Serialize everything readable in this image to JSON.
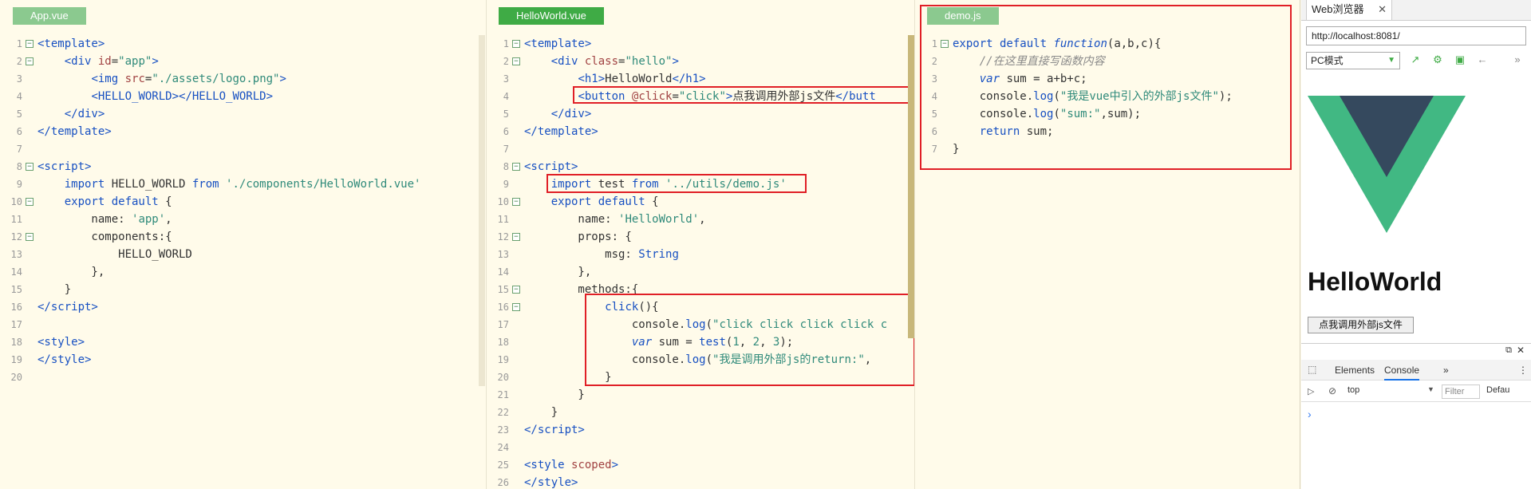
{
  "panes": [
    {
      "tab": "App.vue",
      "lines": [
        {
          "n": "1",
          "f": "⊟",
          "h": "<span class=\"tg\">&lt;template&gt;</span>"
        },
        {
          "n": "2",
          "f": "⊟",
          "h": "    <span class=\"tg\">&lt;div</span> <span class=\"at\">id</span>=<span class=\"st\">\"app\"</span><span class=\"tg\">&gt;</span>"
        },
        {
          "n": "3",
          "f": "",
          "h": "        <span class=\"tg\">&lt;img</span> <span class=\"at\">src</span>=<span class=\"st\">\"./assets/logo.png\"</span><span class=\"tg\">&gt;</span>"
        },
        {
          "n": "4",
          "f": "",
          "h": "        <span class=\"tg\">&lt;HELLO_WORLD&gt;&lt;/HELLO_WORLD&gt;</span>"
        },
        {
          "n": "5",
          "f": "",
          "h": "    <span class=\"tg\">&lt;/div&gt;</span>"
        },
        {
          "n": "6",
          "f": "",
          "h": "<span class=\"tg\">&lt;/template&gt;</span>"
        },
        {
          "n": "7",
          "f": "",
          "h": ""
        },
        {
          "n": "8",
          "f": "⊟",
          "h": "<span class=\"tg\">&lt;script&gt;</span>"
        },
        {
          "n": "9",
          "f": "",
          "h": "    <span class=\"kw\">import</span> HELLO_WORLD <span class=\"kw\">from</span> <span class=\"st\">'./components/HelloWorld.vue'</span>"
        },
        {
          "n": "10",
          "f": "⊟",
          "h": "    <span class=\"kw\">export default</span> {"
        },
        {
          "n": "11",
          "f": "",
          "h": "        name: <span class=\"st\">'app'</span>,"
        },
        {
          "n": "12",
          "f": "⊟",
          "h": "        components:{"
        },
        {
          "n": "13",
          "f": "",
          "h": "            HELLO_WORLD"
        },
        {
          "n": "14",
          "f": "",
          "h": "        },"
        },
        {
          "n": "15",
          "f": "",
          "h": "    }"
        },
        {
          "n": "16",
          "f": "",
          "h": "<span class=\"tg\">&lt;/script&gt;</span>"
        },
        {
          "n": "17",
          "f": "",
          "h": ""
        },
        {
          "n": "18",
          "f": "",
          "h": "<span class=\"tg\">&lt;style&gt;</span>"
        },
        {
          "n": "19",
          "f": "",
          "h": "<span class=\"tg\">&lt;/style&gt;</span>"
        },
        {
          "n": "20",
          "f": "",
          "h": ""
        }
      ]
    },
    {
      "tab": "HelloWorld.vue",
      "lines": [
        {
          "n": "1",
          "f": "⊟",
          "h": "<span class=\"tg\">&lt;template&gt;</span>"
        },
        {
          "n": "2",
          "f": "⊟",
          "h": "    <span class=\"tg\">&lt;div</span> <span class=\"at\">class</span>=<span class=\"st\">\"hello\"</span><span class=\"tg\">&gt;</span>"
        },
        {
          "n": "3",
          "f": "",
          "h": "        <span class=\"tg\">&lt;h1&gt;</span>HelloWorld<span class=\"tg\">&lt;/h1&gt;</span>"
        },
        {
          "n": "4",
          "f": "",
          "h": "        <span class=\"tg\">&lt;button</span> <span class=\"at\">@click</span>=<span class=\"st\">\"click\"</span><span class=\"tg\">&gt;</span>点我调用外部js文件<span class=\"tg\">&lt;/butt</span>"
        },
        {
          "n": "5",
          "f": "",
          "h": "    <span class=\"tg\">&lt;/div&gt;</span>"
        },
        {
          "n": "6",
          "f": "",
          "h": "<span class=\"tg\">&lt;/template&gt;</span>"
        },
        {
          "n": "7",
          "f": "",
          "h": ""
        },
        {
          "n": "8",
          "f": "⊟",
          "h": "<span class=\"tg\">&lt;script&gt;</span>"
        },
        {
          "n": "9",
          "f": "",
          "h": "    <span class=\"kw\">import</span> test <span class=\"kw\">from</span> <span class=\"st\">'../utils/demo.js'</span>"
        },
        {
          "n": "10",
          "f": "⊟",
          "h": "    <span class=\"kw\">export default</span> {"
        },
        {
          "n": "11",
          "f": "",
          "h": "        name: <span class=\"st\">'HelloWorld'</span>,"
        },
        {
          "n": "12",
          "f": "⊟",
          "h": "        props: {"
        },
        {
          "n": "13",
          "f": "",
          "h": "            msg: <span class=\"fn\">String</span>"
        },
        {
          "n": "14",
          "f": "",
          "h": "        },"
        },
        {
          "n": "15",
          "f": "⊟",
          "h": "        methods:{"
        },
        {
          "n": "16",
          "f": "⊟",
          "h": "            <span class=\"fn\">click</span>(){"
        },
        {
          "n": "17",
          "f": "",
          "h": "                console.<span class=\"fn\">log</span>(<span class=\"st\">\"click click click click c</span>"
        },
        {
          "n": "18",
          "f": "",
          "h": "                <span class=\"vr\">var</span> sum = <span class=\"fn\">test</span>(<span class=\"st\">1</span>, <span class=\"st\">2</span>, <span class=\"st\">3</span>);"
        },
        {
          "n": "19",
          "f": "",
          "h": "                console.<span class=\"fn\">log</span>(<span class=\"st\">\"我是调用外部js的return:\"</span>,"
        },
        {
          "n": "20",
          "f": "",
          "h": "            }"
        },
        {
          "n": "21",
          "f": "",
          "h": "        }"
        },
        {
          "n": "22",
          "f": "",
          "h": "    }"
        },
        {
          "n": "23",
          "f": "",
          "h": "<span class=\"tg\">&lt;/script&gt;</span>"
        },
        {
          "n": "24",
          "f": "",
          "h": ""
        },
        {
          "n": "25",
          "f": "",
          "h": "<span class=\"tg\">&lt;style</span> <span class=\"at\">scoped</span><span class=\"tg\">&gt;</span>"
        },
        {
          "n": "26",
          "f": "",
          "h": "<span class=\"tg\">&lt;/style&gt;</span>"
        }
      ]
    },
    {
      "tab": "demo.js",
      "lines": [
        {
          "n": "1",
          "f": "⊟",
          "h": "<span class=\"kw\">export default</span> <span class=\"vr\">function</span>(a,b,c){"
        },
        {
          "n": "2",
          "f": "",
          "h": "    <span class=\"cm\">//在这里直接写函数内容</span>"
        },
        {
          "n": "3",
          "f": "",
          "h": "    <span class=\"vr\">var</span> sum = a+b+c;"
        },
        {
          "n": "4",
          "f": "",
          "h": "    console.<span class=\"fn\">log</span>(<span class=\"st\">\"我是vue中引入的外部js文件\"</span>);"
        },
        {
          "n": "5",
          "f": "",
          "h": "    console.<span class=\"fn\">log</span>(<span class=\"st\">\"sum:\"</span>,sum);"
        },
        {
          "n": "6",
          "f": "",
          "h": "    <span class=\"kw\">return</span> sum;"
        },
        {
          "n": "7",
          "f": "",
          "h": "}"
        }
      ]
    }
  ],
  "browser": {
    "tab_title": "Web浏览器",
    "tab_close": "✕",
    "url": "http://localhost:8081/",
    "mode": "PC模式",
    "heading": "HelloWorld",
    "button_label": "点我调用外部js文件",
    "devtools": {
      "tabs": [
        "Elements",
        "Console"
      ],
      "more": "»",
      "context": "top",
      "filter_placeholder": "Filter",
      "levels": "Defau",
      "prompt": "›"
    }
  },
  "colors": {
    "editor_bg": "#fffbea",
    "tab_active": "#3fab45",
    "tab_inactive": "#8bc98f",
    "highlight_box": "#e01f26",
    "vue_green": "#41b883",
    "vue_dark": "#35495e"
  }
}
